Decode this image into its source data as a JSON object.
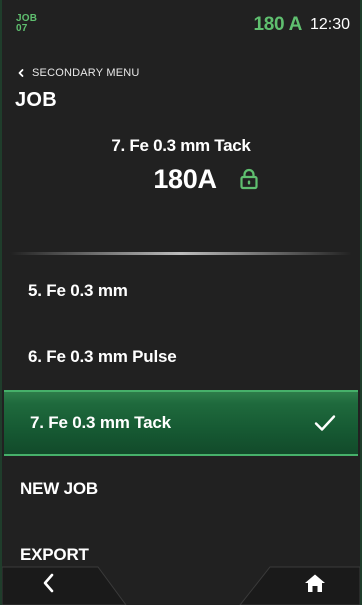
{
  "status_bar": {
    "job_label_line1": "JOB",
    "job_label_line2": "07",
    "current": "180 A",
    "clock": "12:30"
  },
  "header": {
    "back_label": "SECONDARY MENU",
    "title": "JOB"
  },
  "current_job": {
    "name": "7. Fe 0.3 mm Tack",
    "current": "180A",
    "locked": true
  },
  "jobs": [
    {
      "label": "5. Fe 0.3 mm",
      "selected": false
    },
    {
      "label": "6. Fe 0.3 mm Pulse",
      "selected": false
    },
    {
      "label": "7. Fe 0.3 mm Tack",
      "selected": true
    }
  ],
  "actions": [
    {
      "label": "NEW JOB"
    },
    {
      "label": "EXPORT"
    }
  ],
  "nav": {
    "back_icon": "chevron-left-icon",
    "home_icon": "home-icon"
  },
  "colors": {
    "accent": "#5fbf6f",
    "selected_row": "#1f6a3d",
    "background": "#212121"
  }
}
